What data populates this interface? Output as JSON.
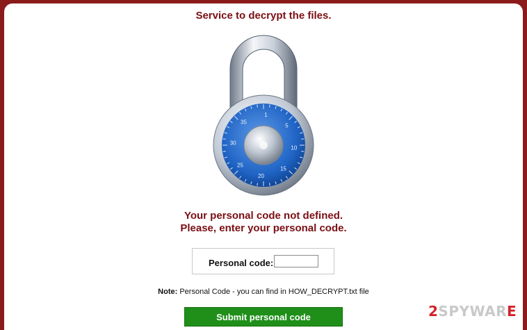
{
  "header": {
    "title": "Service to decrypt the files."
  },
  "lock": {
    "dial_numbers": [
      "1",
      "5",
      "10",
      "15",
      "20",
      "25",
      "30",
      "35"
    ]
  },
  "message": {
    "line1": "Your personal code not defined.",
    "line2": "Please, enter your personal code."
  },
  "form": {
    "label": "Personal code:",
    "input_value": "",
    "input_placeholder": ""
  },
  "note": {
    "prefix": "Note:",
    "text": " Personal Code - you can find in HOW_DECRYPT.txt file"
  },
  "submit": {
    "label": "Submit personal code"
  },
  "watermark": {
    "prefix": "2",
    "rest": "SPYWAR",
    "icon": "E"
  },
  "colors": {
    "background": "#8b1a1a",
    "title": "#7b0f14",
    "submit": "#1f8f1a",
    "dial_blue": "#1f63c4"
  }
}
